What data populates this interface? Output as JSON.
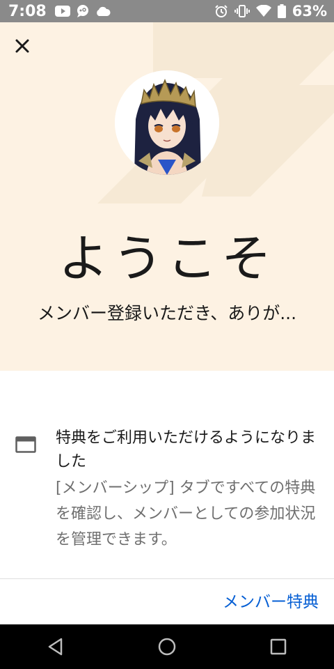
{
  "status_bar": {
    "time": "7:08",
    "battery": "63%",
    "left_icons": [
      "youtube-icon",
      "chat-bubble-icon",
      "cloud-icon"
    ],
    "right_icons": [
      "alarm-icon",
      "vibrate-icon",
      "wifi-icon",
      "battery-icon"
    ]
  },
  "hero": {
    "title": "ようこそ",
    "subtitle": "メンバー登録いただき、ありが..."
  },
  "benefit": {
    "icon": "picture-in-picture-icon",
    "title": "特典をご利用いただけるようになりました",
    "description": "[メンバーシップ] タブですべての特典を確認し、メンバーとしての参加状況を管理できます。"
  },
  "actions": {
    "member_benefits_label": "メンバー特典"
  },
  "colors": {
    "hero_background": "#fdf2e3",
    "link": "#065fd4",
    "status_bar": "#8a8a8a",
    "nav_bar": "#000000"
  }
}
